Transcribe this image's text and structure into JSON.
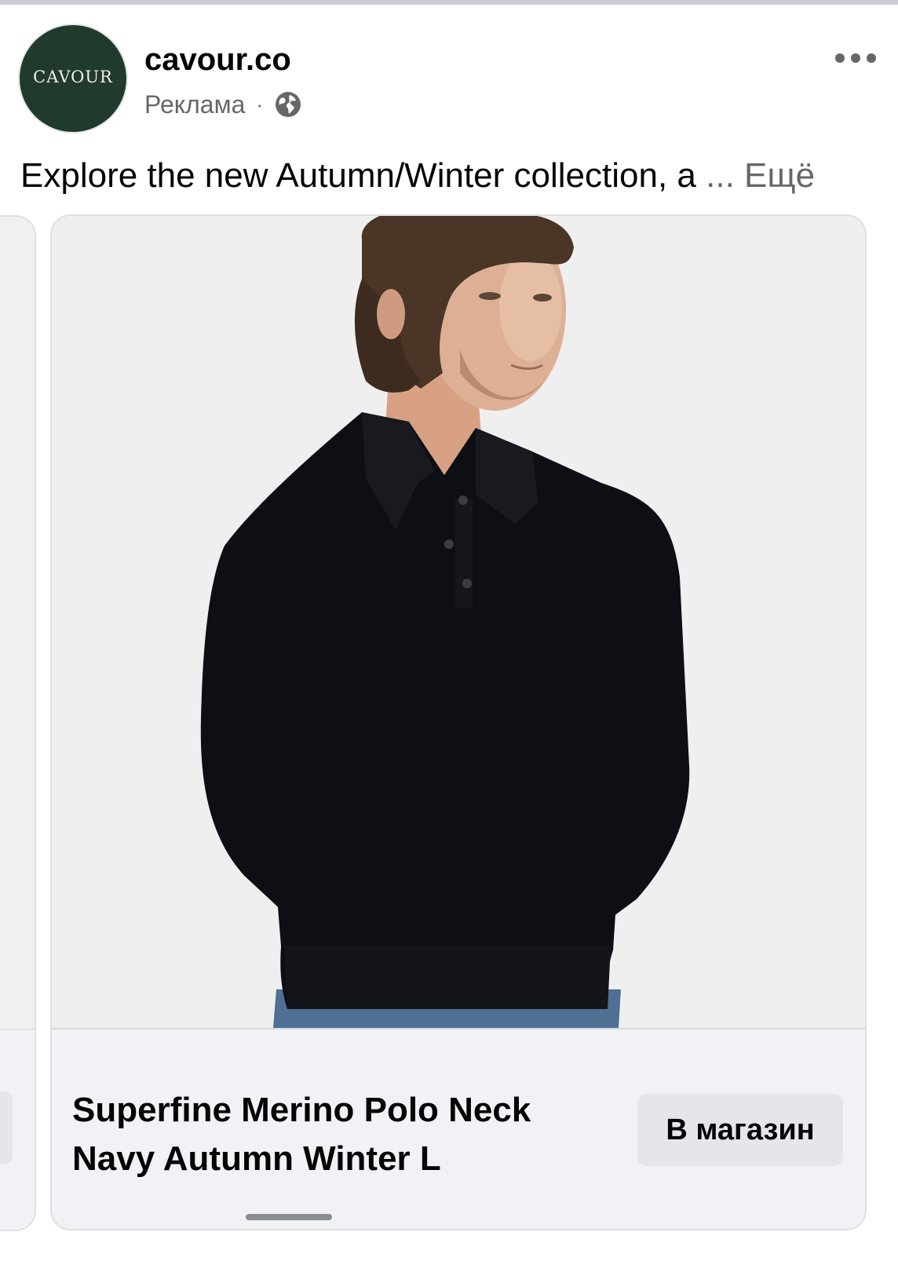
{
  "post": {
    "page_name": "cavour.co",
    "avatar_text": "CAVOUR",
    "sponsored_label": "Реклама",
    "dot": "·",
    "caption_text": "Explore the new Autumn/Winter collection, a",
    "caption_ellipsis": " ... ",
    "see_more": "Ещё"
  },
  "carousel": {
    "card": {
      "title": "Superfine Merino Polo Neck Navy Autumn Winter L",
      "button_label": "В магазин"
    }
  },
  "colors": {
    "avatar_bg": "#203b2c",
    "secondary_text": "#65676b",
    "footer_bg": "#f0f2f5",
    "button_bg": "#e4e6eb"
  },
  "icons": [
    "globe-icon",
    "more-options-icon"
  ]
}
